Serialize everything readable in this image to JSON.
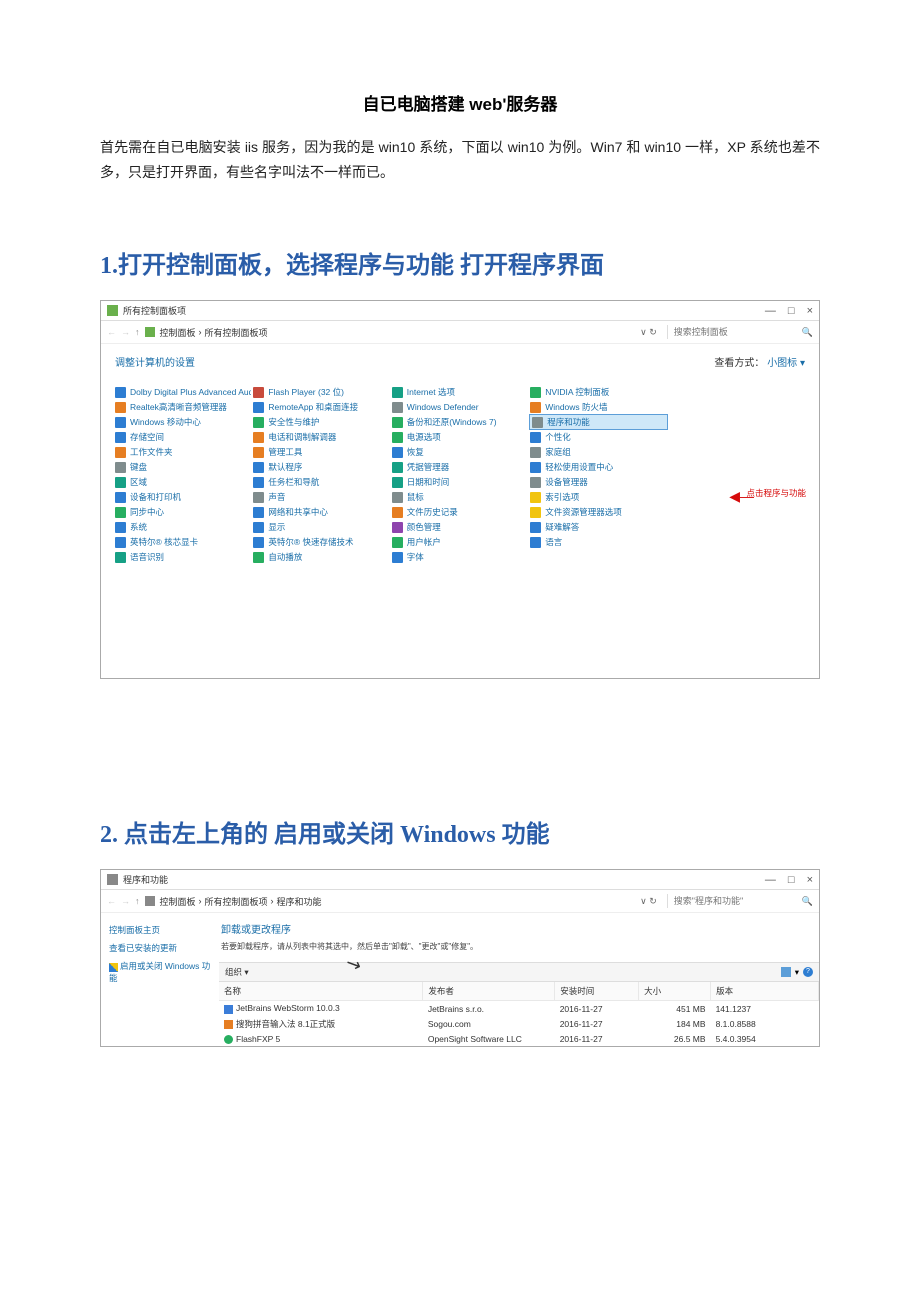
{
  "doc": {
    "title": "自已电脑搭建 web'服务器",
    "intro": "首先需在自已电脑安装 iis 服务，因为我的是 win10 系统，下面以 win10 为例。Win7 和 win10 一样，XP 系统也差不多，只是打开界面，有些名字叫法不一样而已。",
    "section1": "1.打开控制面板，选择程序与功能  打开程序界面",
    "section2": "2. 点击左上角的  启用或关闭 Windows 功能"
  },
  "shot1": {
    "window_title": "所有控制面板项",
    "winbtns": {
      "min": "—",
      "max": "□",
      "close": "×"
    },
    "nav": {
      "back": "←",
      "fwd": "→",
      "up": "↑"
    },
    "breadcrumb": {
      "a": "控制面板",
      "sep": "›",
      "b": "所有控制面板项"
    },
    "refresh": "∨ ↻",
    "search_placeholder": "搜索控制面板",
    "magnifier": "🔍",
    "adjust_label": "调整计算机的设置",
    "view_label": "查看方式：",
    "view_value": "小图标 ▾",
    "callout_text": "点击程序与功能",
    "callout_arrow": "◀—",
    "items": [
      {
        "label": "Dolby Digital Plus Advanced Audio",
        "c": "ic-blue"
      },
      {
        "label": "Flash Player (32 位)",
        "c": "ic-red"
      },
      {
        "label": "Internet 选项",
        "c": "ic-teal"
      },
      {
        "label": "NVIDIA 控制面板",
        "c": "ic-green"
      },
      {
        "label": ""
      },
      {
        "label": "Realtek高清晰音频管理器",
        "c": "ic-orange"
      },
      {
        "label": "RemoteApp 和桌面连接",
        "c": "ic-blue"
      },
      {
        "label": "Windows Defender",
        "c": "ic-gray"
      },
      {
        "label": "Windows 防火墙",
        "c": "ic-orange"
      },
      {
        "label": ""
      },
      {
        "label": "Windows 移动中心",
        "c": "ic-blue"
      },
      {
        "label": "安全性与维护",
        "c": "ic-green"
      },
      {
        "label": "备份和还原(Windows 7)",
        "c": "ic-green"
      },
      {
        "label": "程序和功能",
        "c": "ic-gray",
        "hl": true
      },
      {
        "label": ""
      },
      {
        "label": "存储空间",
        "c": "ic-blue"
      },
      {
        "label": "电话和调制解调器",
        "c": "ic-orange"
      },
      {
        "label": "电源选项",
        "c": "ic-green"
      },
      {
        "label": "个性化",
        "c": "ic-blue"
      },
      {
        "label": ""
      },
      {
        "label": "工作文件夹",
        "c": "ic-orange"
      },
      {
        "label": "管理工具",
        "c": "ic-orange"
      },
      {
        "label": "恢复",
        "c": "ic-blue"
      },
      {
        "label": "家庭组",
        "c": "ic-gray"
      },
      {
        "label": ""
      },
      {
        "label": "键盘",
        "c": "ic-gray"
      },
      {
        "label": "默认程序",
        "c": "ic-blue"
      },
      {
        "label": "凭据管理器",
        "c": "ic-teal"
      },
      {
        "label": "轻松使用设置中心",
        "c": "ic-blue"
      },
      {
        "label": ""
      },
      {
        "label": "区域",
        "c": "ic-teal"
      },
      {
        "label": "任务栏和导航",
        "c": "ic-blue"
      },
      {
        "label": "日期和时间",
        "c": "ic-teal"
      },
      {
        "label": "设备管理器",
        "c": "ic-gray"
      },
      {
        "label": ""
      },
      {
        "label": "设备和打印机",
        "c": "ic-blue"
      },
      {
        "label": "声音",
        "c": "ic-gray"
      },
      {
        "label": "鼠标",
        "c": "ic-gray"
      },
      {
        "label": "索引选项",
        "c": "ic-yellow"
      },
      {
        "label": ""
      },
      {
        "label": "同步中心",
        "c": "ic-green"
      },
      {
        "label": "网络和共享中心",
        "c": "ic-blue"
      },
      {
        "label": "文件历史记录",
        "c": "ic-orange"
      },
      {
        "label": "文件资源管理器选项",
        "c": "ic-yellow"
      },
      {
        "label": ""
      },
      {
        "label": "系统",
        "c": "ic-blue"
      },
      {
        "label": "显示",
        "c": "ic-blue"
      },
      {
        "label": "颜色管理",
        "c": "ic-purple"
      },
      {
        "label": "疑难解答",
        "c": "ic-blue"
      },
      {
        "label": ""
      },
      {
        "label": "英特尔® 核芯显卡",
        "c": "ic-blue"
      },
      {
        "label": "英特尔® 快速存储技术",
        "c": "ic-blue"
      },
      {
        "label": "用户帐户",
        "c": "ic-green"
      },
      {
        "label": "语言",
        "c": "ic-blue"
      },
      {
        "label": ""
      },
      {
        "label": "语音识别",
        "c": "ic-teal"
      },
      {
        "label": "自动播放",
        "c": "ic-green"
      },
      {
        "label": "字体",
        "c": "ic-blue"
      },
      {
        "label": ""
      },
      {
        "label": ""
      }
    ]
  },
  "shot2": {
    "window_title": "程序和功能",
    "winbtns": {
      "min": "—",
      "max": "□",
      "close": "×"
    },
    "nav": {
      "back": "←",
      "fwd": "→",
      "up": "↑"
    },
    "breadcrumb": {
      "a": "控制面板",
      "sep": "›",
      "b": "所有控制面板项",
      "c": "程序和功能"
    },
    "refresh": "∨ ↻",
    "search_placeholder": "搜索\"程序和功能\"",
    "magnifier": "🔍",
    "sidebar": {
      "home": "控制面板主页",
      "updates": "查看已安装的更新",
      "windows_features": "启用或关闭 Windows 功能"
    },
    "main": {
      "title": "卸载或更改程序",
      "desc": "若要卸载程序，请从列表中将其选中，然后单击\"卸载\"、\"更改\"或\"修复\"。",
      "organize": "组织 ▾"
    },
    "table": {
      "headers": {
        "name": "名称",
        "pub": "发布者",
        "date": "安装时间",
        "size": "大小",
        "ver": "版本"
      },
      "rows": [
        {
          "name": "JetBrains WebStorm 10.0.3",
          "pub": "JetBrains s.r.o.",
          "date": "2016-11-27",
          "size": "451 MB",
          "ver": "141.1237",
          "pc": "pic-blue"
        },
        {
          "name": "搜狗拼音输入法 8.1正式版",
          "pub": "Sogou.com",
          "date": "2016-11-27",
          "size": "184 MB",
          "ver": "8.1.0.8588",
          "pc": "pic-orange"
        },
        {
          "name": "FlashFXP 5",
          "pub": "OpenSight Software LLC",
          "date": "2016-11-27",
          "size": "26.5 MB",
          "ver": "5.4.0.3954",
          "pc": "pic-green"
        }
      ]
    },
    "arrow": "↘"
  }
}
